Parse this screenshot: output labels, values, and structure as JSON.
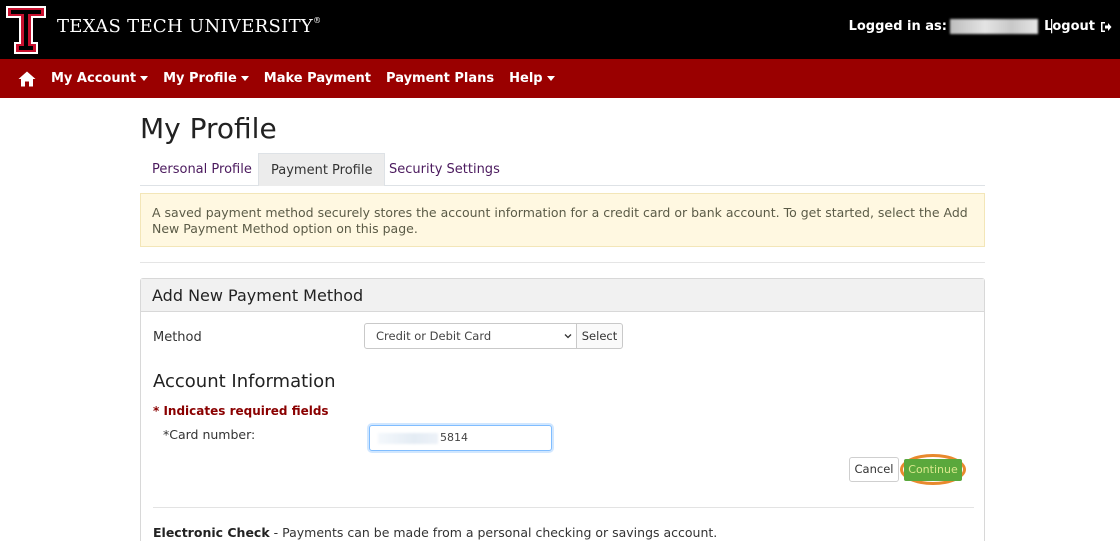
{
  "header": {
    "university_name": "Texas Tech University",
    "trademark": "®",
    "logged_in_label": "Logged in as:",
    "separator": "|",
    "logout_label": "Logout"
  },
  "nav": {
    "items": [
      {
        "label": "My Account",
        "dropdown": true
      },
      {
        "label": "My Profile",
        "dropdown": true
      },
      {
        "label": "Make Payment",
        "dropdown": false
      },
      {
        "label": "Payment Plans",
        "dropdown": false
      },
      {
        "label": "Help",
        "dropdown": true
      }
    ]
  },
  "page": {
    "title": "My Profile",
    "tabs": [
      {
        "label": "Personal Profile",
        "active": false
      },
      {
        "label": "Payment Profile",
        "active": true
      },
      {
        "label": "Security Settings",
        "active": false
      }
    ],
    "alert": "A saved payment method securely stores the account information for a credit card or bank account. To get started, select the Add New Payment Method option on this page."
  },
  "card": {
    "header": "Add New Payment Method",
    "method_label": "Method",
    "method_selected": "Credit or Debit Card",
    "select_button": "Select",
    "account_title": "Account Information",
    "required_note": "* Indicates required fields",
    "card_number_label": "*Card number:",
    "card_number_value": "5814",
    "cancel_label": "Cancel",
    "continue_label": "Continue",
    "echeck_title": "Electronic Check",
    "echeck_text": " - Payments can be made from a personal checking or savings account."
  },
  "colors": {
    "header_bg": "#000000",
    "nav_bg": "#9a0000",
    "tab_link": "#4b1a5e",
    "alert_bg": "#fff8e1",
    "continue_bg": "#5aa83c",
    "highlight": "#e8892d"
  }
}
